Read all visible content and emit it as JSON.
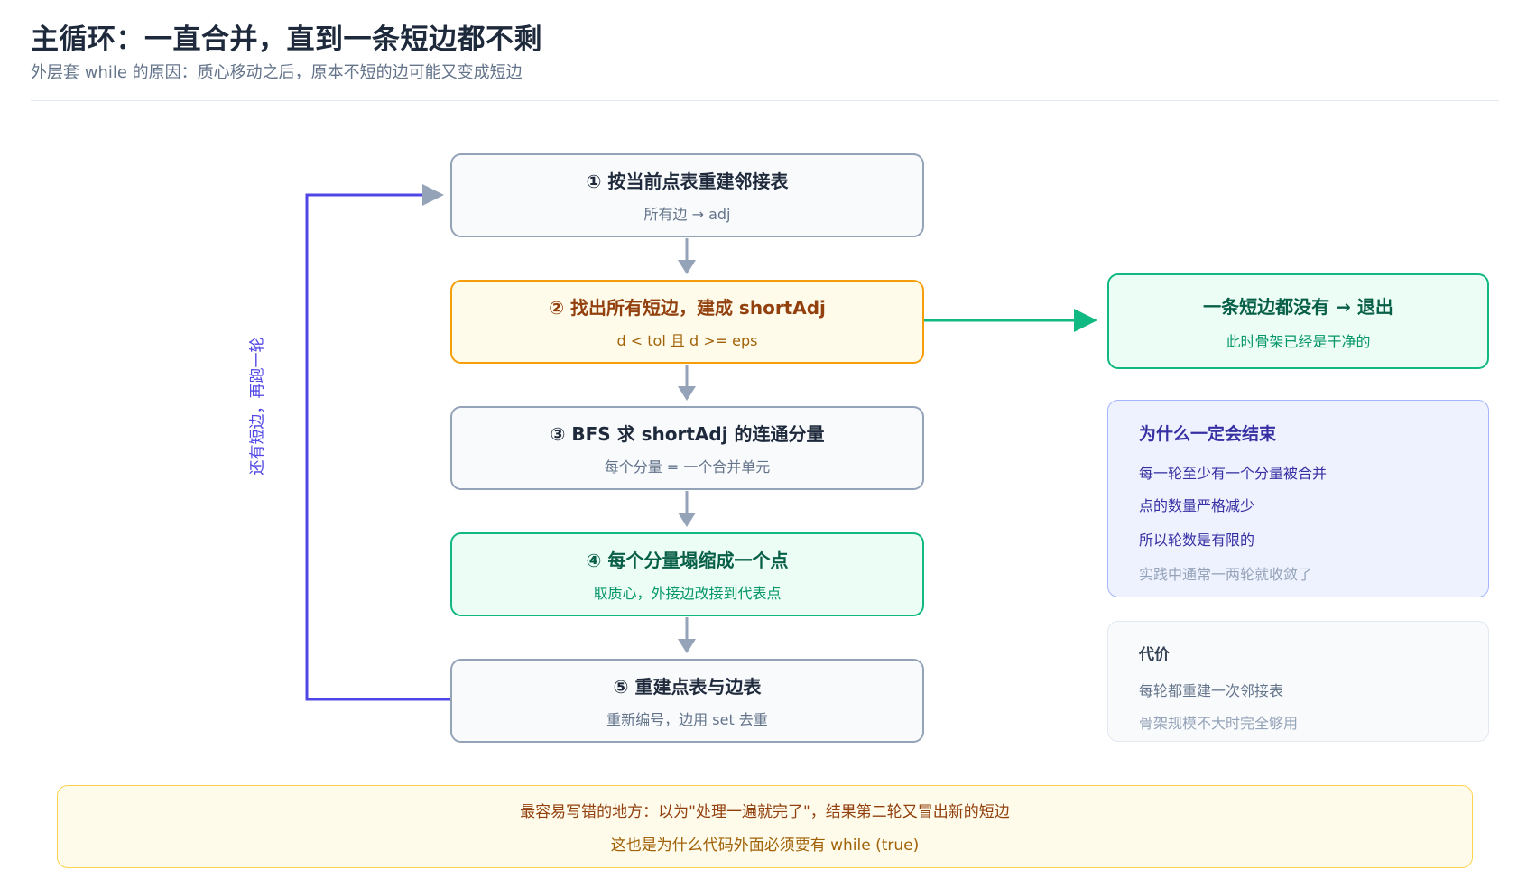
{
  "header": {
    "title": "主循环：一直合并，直到一条短边都不剩",
    "subtitle": "外层套 while 的原因：质心移动之后，原本不短的边可能又变成短边"
  },
  "steps": [
    {
      "title": "① 按当前点表重建邻接表",
      "sub": "所有边 → adj"
    },
    {
      "title": "② 找出所有短边，建成 shortAdj",
      "sub": "d < tol 且 d >= eps"
    },
    {
      "title": "③ BFS 求 shortAdj 的连通分量",
      "sub": "每个分量 = 一个合并单元"
    },
    {
      "title": "④ 每个分量塌缩成一个点",
      "sub": "取质心，外接边改接到代表点"
    },
    {
      "title": "⑤ 重建点表与边表",
      "sub": "重新编号，边用 set 去重"
    }
  ],
  "loop": {
    "label": "还有短边，再跑一轮"
  },
  "exit": {
    "title": "一条短边都没有 → 退出",
    "sub": "此时骨架已经是干净的"
  },
  "why": {
    "title": "为什么一定会结束",
    "lines": [
      "每一轮至少有一个分量被合并",
      "点的数量严格减少",
      "所以轮数是有限的",
      "实践中通常一两轮就收敛了"
    ]
  },
  "cost": {
    "title": "代价",
    "lines": [
      "每轮都重建一次邻接表",
      "骨架规模不大时完全够用"
    ]
  },
  "note": {
    "line1": "最容易写错的地方：以为\"处理一遍就完了\"，结果第二轮又冒出新的短边",
    "line2": "这也是为什么代码外面必须要有 while (true)"
  },
  "colors": {
    "loop_arrow": "#4f46e5",
    "exit_arrow": "#10b981",
    "flow_arrow": "#94a3b8",
    "short_border": "#f59e0b",
    "collapse_border": "#10b981"
  }
}
